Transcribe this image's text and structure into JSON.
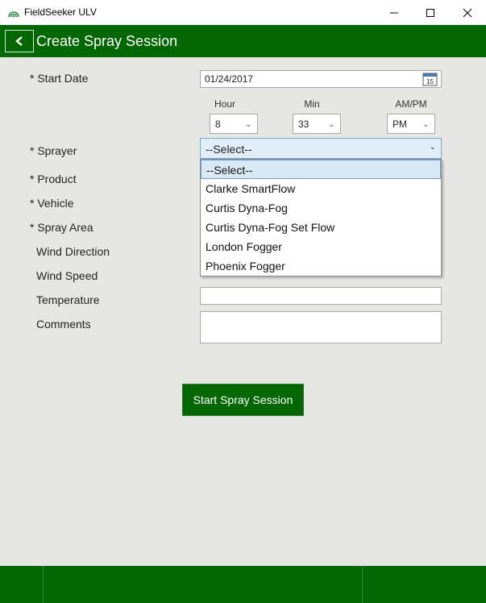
{
  "window": {
    "app_title": "FieldSeeker ULV",
    "app_icon": "fieldseeker-logo-icon",
    "controls": [
      "minimize-icon",
      "maximize-icon",
      "close-icon"
    ]
  },
  "header": {
    "back_icon": "chevron-left-icon",
    "title": "Create Spray Session",
    "color": "#036803"
  },
  "form": {
    "start_date": {
      "label": "* Start Date",
      "value": "01/24/2017",
      "calendar_day": "15"
    },
    "time": {
      "hour_label": "Hour",
      "hour_value": "8",
      "min_label": "Min",
      "min_value": "33",
      "ampm_label": "AM/PM",
      "ampm_value": "PM"
    },
    "sprayer": {
      "label": "* Sprayer",
      "value": "--Select--",
      "options": [
        "--Select--",
        "Clarke SmartFlow",
        "Curtis Dyna-Fog",
        "Curtis Dyna-Fog Set Flow",
        "London Fogger",
        "Phoenix Fogger"
      ]
    },
    "product_label": "* Product",
    "vehicle_label": "* Vehicle",
    "spray_area_label": "* Spray Area",
    "wind_direction_label": "Wind Direction",
    "wind_speed_label": "Wind Speed",
    "temperature_label": "Temperature",
    "temperature_value": "",
    "comments_label": "Comments",
    "comments_value": ""
  },
  "actions": {
    "start_label": "Start Spray Session"
  }
}
